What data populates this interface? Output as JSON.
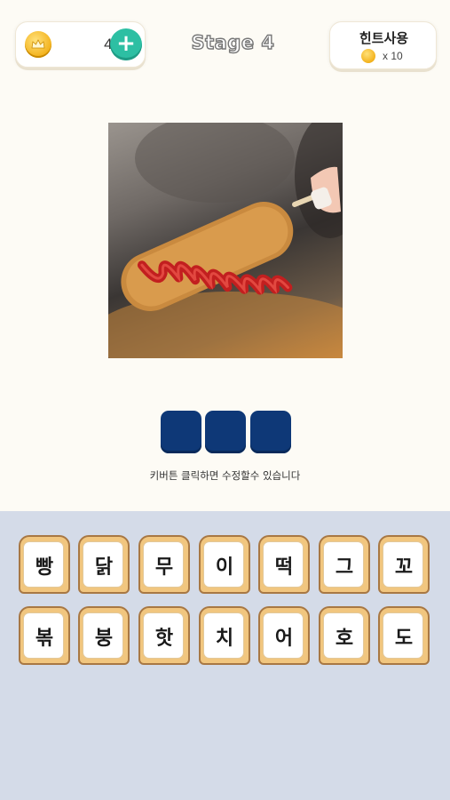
{
  "header": {
    "coins": "40",
    "stage_title": "Stage 4",
    "hint_title": "힌트사용",
    "hint_cost": "x 10"
  },
  "puzzle": {
    "slots": [
      "",
      "",
      ""
    ],
    "instruction": "키버튼 클릭하면 수정할수 있습니다"
  },
  "keyboard": {
    "row1": [
      "빵",
      "닭",
      "무",
      "이",
      "떡",
      "그",
      "꼬"
    ],
    "row2": [
      "볶",
      "붕",
      "핫",
      "치",
      "어",
      "호",
      "도"
    ]
  },
  "colors": {
    "background": "#fdfbf5",
    "keyboard_bg": "#d4dbe8",
    "slot": "#0e3877",
    "plus_button": "#2dbfa3",
    "coin": "#f3b21c",
    "tile_crust": "#f1c67f"
  },
  "icons": {
    "coin": "crown-coin-icon",
    "plus": "plus-icon"
  }
}
